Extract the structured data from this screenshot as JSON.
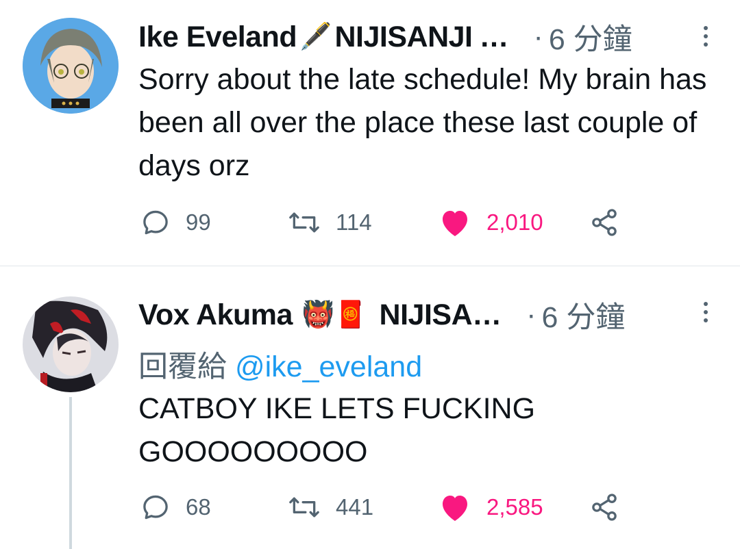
{
  "tweets": [
    {
      "author": "Ike Eveland",
      "author_emoji": "🖋️",
      "affiliation": "NIJISANJI",
      "ellipsis": "…",
      "dot": "·",
      "time": "6 分鐘",
      "text": "Sorry about the late schedule! My brain has been all over the place these last couple of days orz",
      "replies": "99",
      "retweets": "114",
      "likes": "2,010",
      "liked": true
    },
    {
      "author": "Vox Akuma",
      "author_emoji": "👹🧧",
      "affiliation": "NIJISA",
      "ellipsis": "…",
      "dot": "·",
      "time": "6 分鐘",
      "reply_prefix": "回覆給",
      "reply_handle": "@ike_eveland",
      "text": "CATBOY IKE LETS FUCKING GOOOOOOOOO",
      "replies": "68",
      "retweets": "441",
      "likes": "2,585",
      "liked": true
    }
  ],
  "colors": {
    "like": "#f91880",
    "link": "#1d9bf0",
    "muted": "#536471"
  }
}
